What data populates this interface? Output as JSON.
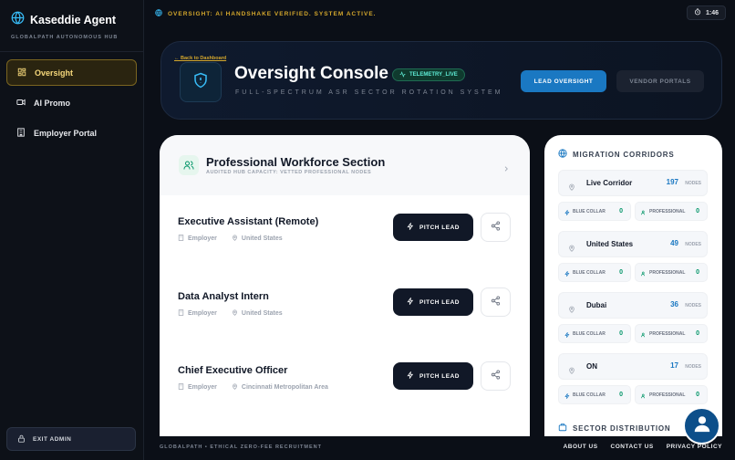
{
  "brand": {
    "title": "Kaseddie Agent",
    "subtitle": "GLOBALPATH AUTONOMOUS HUB"
  },
  "sidebar": {
    "items": [
      {
        "label": "Oversight",
        "icon": "grid-icon",
        "active": true
      },
      {
        "label": "AI Promo",
        "icon": "video-icon",
        "active": false
      },
      {
        "label": "Employer Portal",
        "icon": "building-icon",
        "active": false
      }
    ],
    "exit_label": "EXIT ADMIN"
  },
  "topbar": {
    "status": "OVERSIGHT: AI HANDSHAKE VERIFIED. SYSTEM ACTIVE.",
    "time": "1:46"
  },
  "header": {
    "back_label": "← Back to Dashboard",
    "title": "Oversight Console",
    "badge": "TELEMETRY_LIVE",
    "subtitle": "FULL-SPECTRUM ASR SECTOR ROTATION SYSTEM",
    "lead_button": "LEAD OVERSIGHT",
    "vendor_button": "VENDOR PORTALS"
  },
  "section": {
    "title": "Professional Workforce Section",
    "subtitle": "AUDITED HUB CAPACITY: VETTED PROFESSIONAL NODES"
  },
  "jobs": [
    {
      "title": "Executive Assistant (Remote)",
      "employer": "Employer",
      "location": "United States",
      "pitch": "PITCH LEAD"
    },
    {
      "title": "Data Analyst Intern",
      "employer": "Employer",
      "location": "United States",
      "pitch": "PITCH LEAD"
    },
    {
      "title": "Chief Executive Officer",
      "employer": "Employer",
      "location": "Cincinnati Metropolitan Area",
      "pitch": "PITCH LEAD"
    }
  ],
  "corridors_panel": {
    "title": "MIGRATION CORRIDORS",
    "nodes_label": "NODES",
    "blue_label": "BLUE COLLAR",
    "pro_label": "PROFESSIONAL",
    "items": [
      {
        "name": "Live Corridor",
        "count": "197",
        "blue": "0",
        "pro": "0"
      },
      {
        "name": "United States",
        "count": "49",
        "blue": "0",
        "pro": "0"
      },
      {
        "name": "Dubai",
        "count": "36",
        "blue": "0",
        "pro": "0"
      },
      {
        "name": "ON",
        "count": "17",
        "blue": "0",
        "pro": "0"
      }
    ],
    "sector_title": "SECTOR DISTRIBUTION"
  },
  "footer": {
    "left": "GLOBALPATH • ETHICAL ZERO-FEE RECRUITMENT",
    "links": [
      "ABOUT US",
      "CONTACT US",
      "PRIVACY POLICY"
    ]
  },
  "colors": {
    "accent_gold": "#d4a72c",
    "accent_blue": "#1a78c2",
    "accent_green": "#059669"
  }
}
